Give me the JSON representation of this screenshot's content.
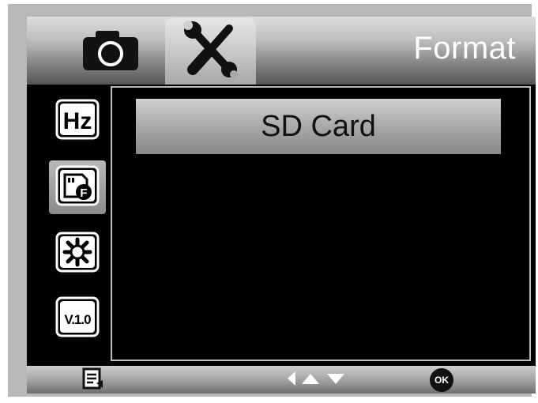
{
  "header": {
    "title": "Format",
    "tabs": [
      {
        "icon": "camera-icon"
      },
      {
        "icon": "tools-icon",
        "selected": true
      }
    ]
  },
  "sidebar": {
    "items": [
      {
        "icon": "frequency-icon",
        "label": "Hz"
      },
      {
        "icon": "sd-format-icon",
        "label": "F",
        "selected": true
      },
      {
        "icon": "brightness-icon"
      },
      {
        "icon": "version-icon",
        "label": "V.1.0"
      }
    ]
  },
  "main": {
    "options": [
      {
        "label": "SD Card",
        "selected": true
      }
    ]
  },
  "footer": {
    "ok_label": "OK",
    "icons": [
      "menu-icon",
      "left-arrow-icon",
      "up-arrow-icon",
      "down-arrow-icon",
      "ok-icon"
    ]
  }
}
